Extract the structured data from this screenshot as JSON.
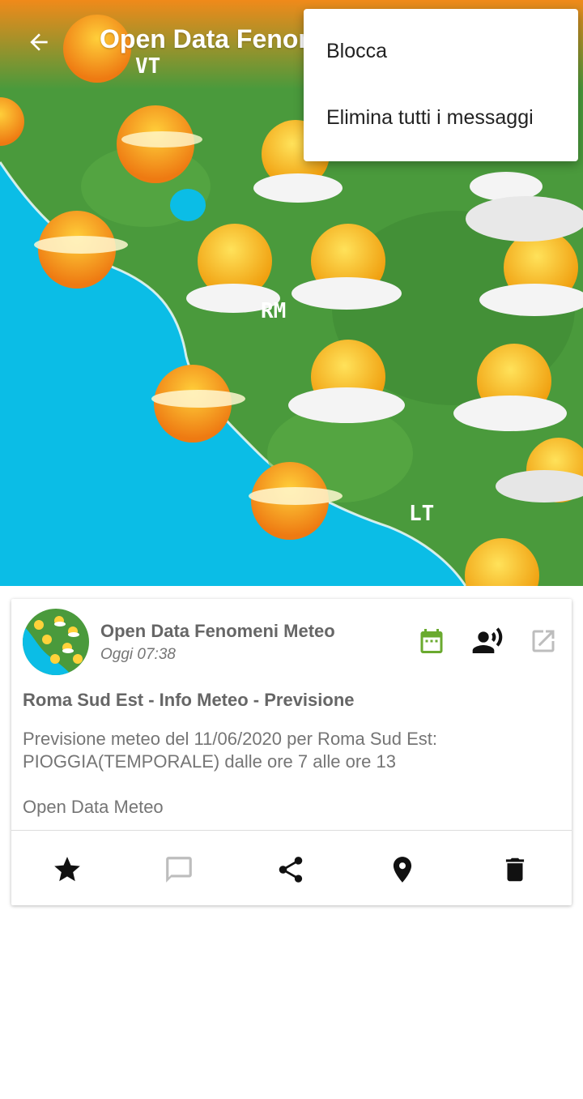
{
  "header": {
    "title": "Open Data Fenomeni Meteo",
    "back_icon": "arrow-left-icon"
  },
  "overflow_menu": {
    "items": [
      {
        "label": "Blocca"
      },
      {
        "label": "Elimina tutti i messaggi"
      }
    ]
  },
  "map": {
    "labels": [
      "VT",
      "RM",
      "LT"
    ]
  },
  "message_card": {
    "sender": "Open Data Fenomeni Meteo",
    "time": "Oggi 07:38",
    "title": "Roma Sud Est - Info Meteo - Previsione",
    "body": "Previsione meteo del 11/06/2020 per Roma Sud Est: PIOGGIA(TEMPORALE) dalle ore 7 alle ore 13",
    "source": "Open Data Meteo",
    "header_icons": [
      "calendar-icon",
      "speak-icon",
      "open-external-icon"
    ],
    "actions": [
      "star-icon",
      "comment-icon",
      "share-icon",
      "location-pin-icon",
      "delete-icon"
    ]
  },
  "colors": {
    "accent_green": "#6aaa2f",
    "sea": "#0bbde6",
    "land": "#4a9a3c",
    "header_orange": "#f08a1a"
  }
}
